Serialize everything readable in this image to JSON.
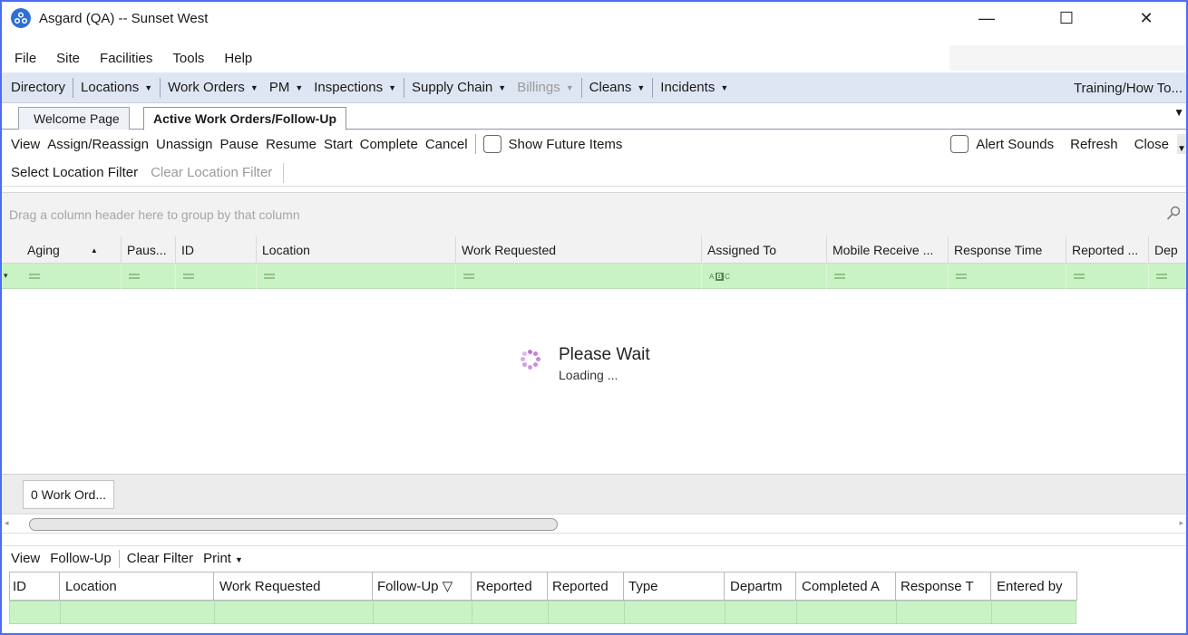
{
  "window": {
    "title": "Asgard (QA) -- Sunset West",
    "minimize": "—",
    "maximize": "☐",
    "close": "✕"
  },
  "menu": [
    "File",
    "Site",
    "Facilities",
    "Tools",
    "Help"
  ],
  "nav": {
    "items": [
      {
        "label": "Directory",
        "caret": false,
        "disabled": false
      },
      {
        "label": "Locations",
        "caret": true,
        "disabled": false
      },
      {
        "label": "Work Orders",
        "caret": true,
        "disabled": false
      },
      {
        "label": "PM",
        "caret": true,
        "disabled": false
      },
      {
        "label": "Inspections",
        "caret": true,
        "disabled": false
      },
      {
        "label": "Supply Chain",
        "caret": true,
        "disabled": false
      },
      {
        "label": "Billings",
        "caret": true,
        "disabled": true
      },
      {
        "label": "Cleans",
        "caret": true,
        "disabled": false
      },
      {
        "label": "Incidents",
        "caret": true,
        "disabled": false
      }
    ],
    "right": "Training/How To..."
  },
  "tabs": {
    "inactive": "Welcome Page",
    "active": "Active Work Orders/Follow-Up"
  },
  "toolbar": {
    "left": [
      "View",
      "Assign/Reassign",
      "Unassign",
      "Pause",
      "Resume",
      "Start",
      "Complete",
      "Cancel"
    ],
    "show_future": "Show Future Items",
    "alert_sounds": "Alert Sounds",
    "refresh": "Refresh",
    "close": "Close"
  },
  "location_filter": {
    "select": "Select Location Filter",
    "clear": "Clear Location Filter"
  },
  "grid": {
    "group_hint": "Drag a column header here to group by that column",
    "columns": [
      "Aging",
      "Paus...",
      "ID",
      "Location",
      "Work Requested",
      "Assigned To",
      "Mobile Receive ...",
      "Response Time",
      "Reported ...",
      "Dep"
    ],
    "sort_caret": "▲",
    "abc": [
      "A",
      "B",
      "C"
    ]
  },
  "loading": {
    "title": "Please Wait",
    "subtitle": "Loading ..."
  },
  "footer": {
    "count": "0 Work Ord..."
  },
  "followup_toolbar": {
    "view": "View",
    "followup": "Follow-Up",
    "clear_filter": "Clear Filter",
    "print": "Print"
  },
  "followup_grid": {
    "columns": [
      "ID",
      "Location",
      "Work Requested",
      "Follow-Up ▽",
      "Reported",
      "Reported",
      "Type",
      "Departm",
      "Completed A",
      "Response T",
      "Entered by"
    ]
  },
  "colors": {
    "accent": "#4a6cf7",
    "nav_bg": "#dfe6f3",
    "filter_green": "#c9f3c4",
    "spinner": "#c072d8"
  }
}
